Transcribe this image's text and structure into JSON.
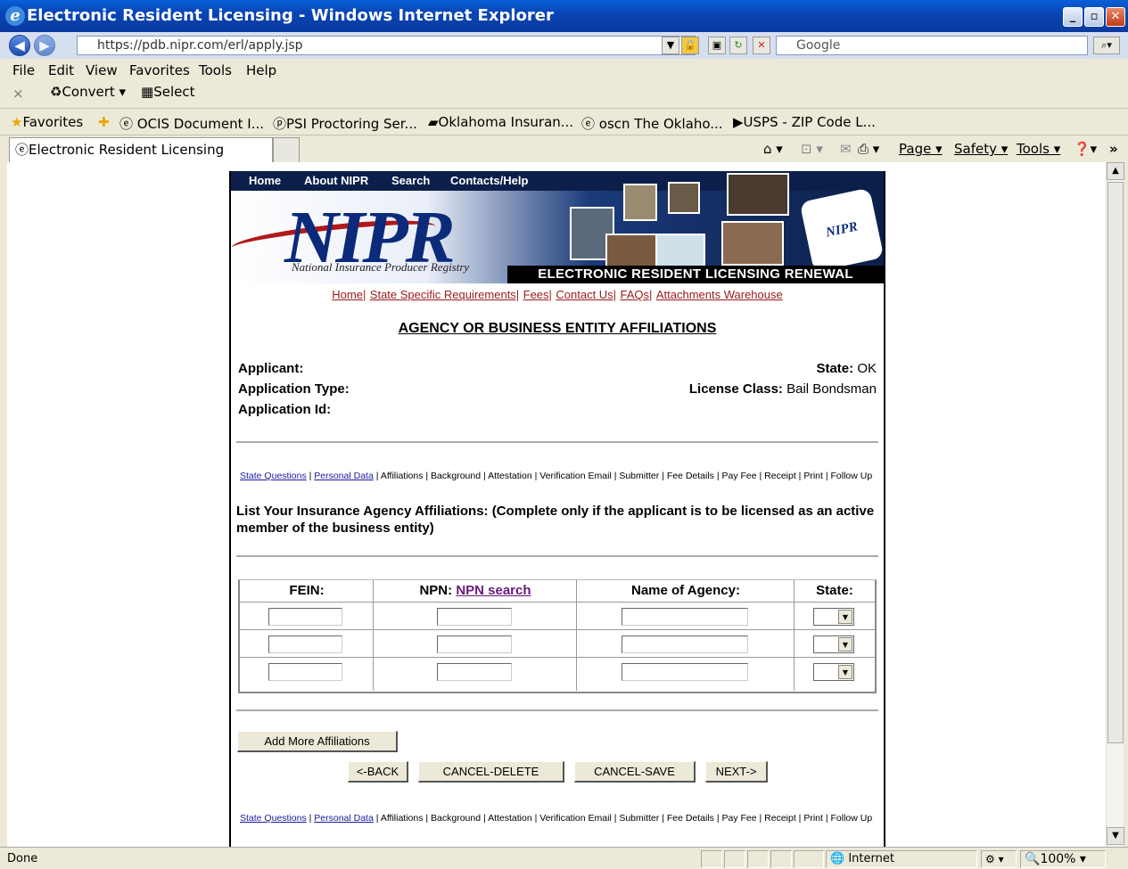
{
  "window": {
    "title": "Electronic Resident Licensing - Windows Internet Explorer"
  },
  "address": {
    "url": "https://pdb.nipr.com/erl/apply.jsp",
    "search_placeholder": "Google"
  },
  "menu": [
    "File",
    "Edit",
    "View",
    "Favorites",
    "Tools",
    "Help"
  ],
  "toolbar2": {
    "convert": "Convert",
    "select": "Select"
  },
  "favorites": {
    "label": "Favorites",
    "items": [
      "OCIS Document I...",
      "PSI Proctoring Ser...",
      "Oklahoma Insuran...",
      "oscn The Oklaho...",
      "USPS - ZIP Code L..."
    ]
  },
  "tab": {
    "title": "Electronic Resident Licensing"
  },
  "commandbar": {
    "page": "Page",
    "safety": "Safety",
    "tools": "Tools"
  },
  "banner": {
    "nav": [
      "Home",
      "About NIPR",
      "Search",
      "Contacts/Help"
    ],
    "logo": "NIPR",
    "logo_sub": "National Insurance Producer Registry",
    "title": "ELECTRONIC RESIDENT LICENSING RENEWAL"
  },
  "toplinks": [
    "Home|",
    "State Specific Requirements|",
    "Fees|",
    "Contact Us|",
    "FAQs|",
    "Attachments Warehouse"
  ],
  "page": {
    "heading": "AGENCY OR BUSINESS ENTITY AFFILIATIONS",
    "applicant_label": "Applicant:",
    "apptype_label": "Application Type:",
    "appid_label": "Application Id:",
    "state_label": "State:",
    "state_value": "OK",
    "licclass_label": "License Class:",
    "licclass_value": "Bail Bondsman",
    "instructions": "List Your Insurance Agency Affiliations: (Complete only if the applicant is to be licensed as an active member of the business entity)"
  },
  "steps": {
    "linked": [
      "State Questions",
      "Personal Data"
    ],
    "plain": "| Affiliations | Background | Attestation | Verification Email | Submitter | Fee Details | Pay Fee | Receipt | Print | Follow Up"
  },
  "table": {
    "fein": "FEIN:",
    "npn": "NPN:",
    "npn_link": "NPN search",
    "agency": "Name of Agency:",
    "state": "State:"
  },
  "buttons": {
    "add_more": "Add More Affiliations",
    "back": "<-BACK",
    "cancel_delete": "CANCEL-DELETE",
    "cancel_save": "CANCEL-SAVE",
    "next": "NEXT->"
  },
  "status": {
    "text": "Done",
    "zone": "Internet",
    "zoom": "100%"
  }
}
